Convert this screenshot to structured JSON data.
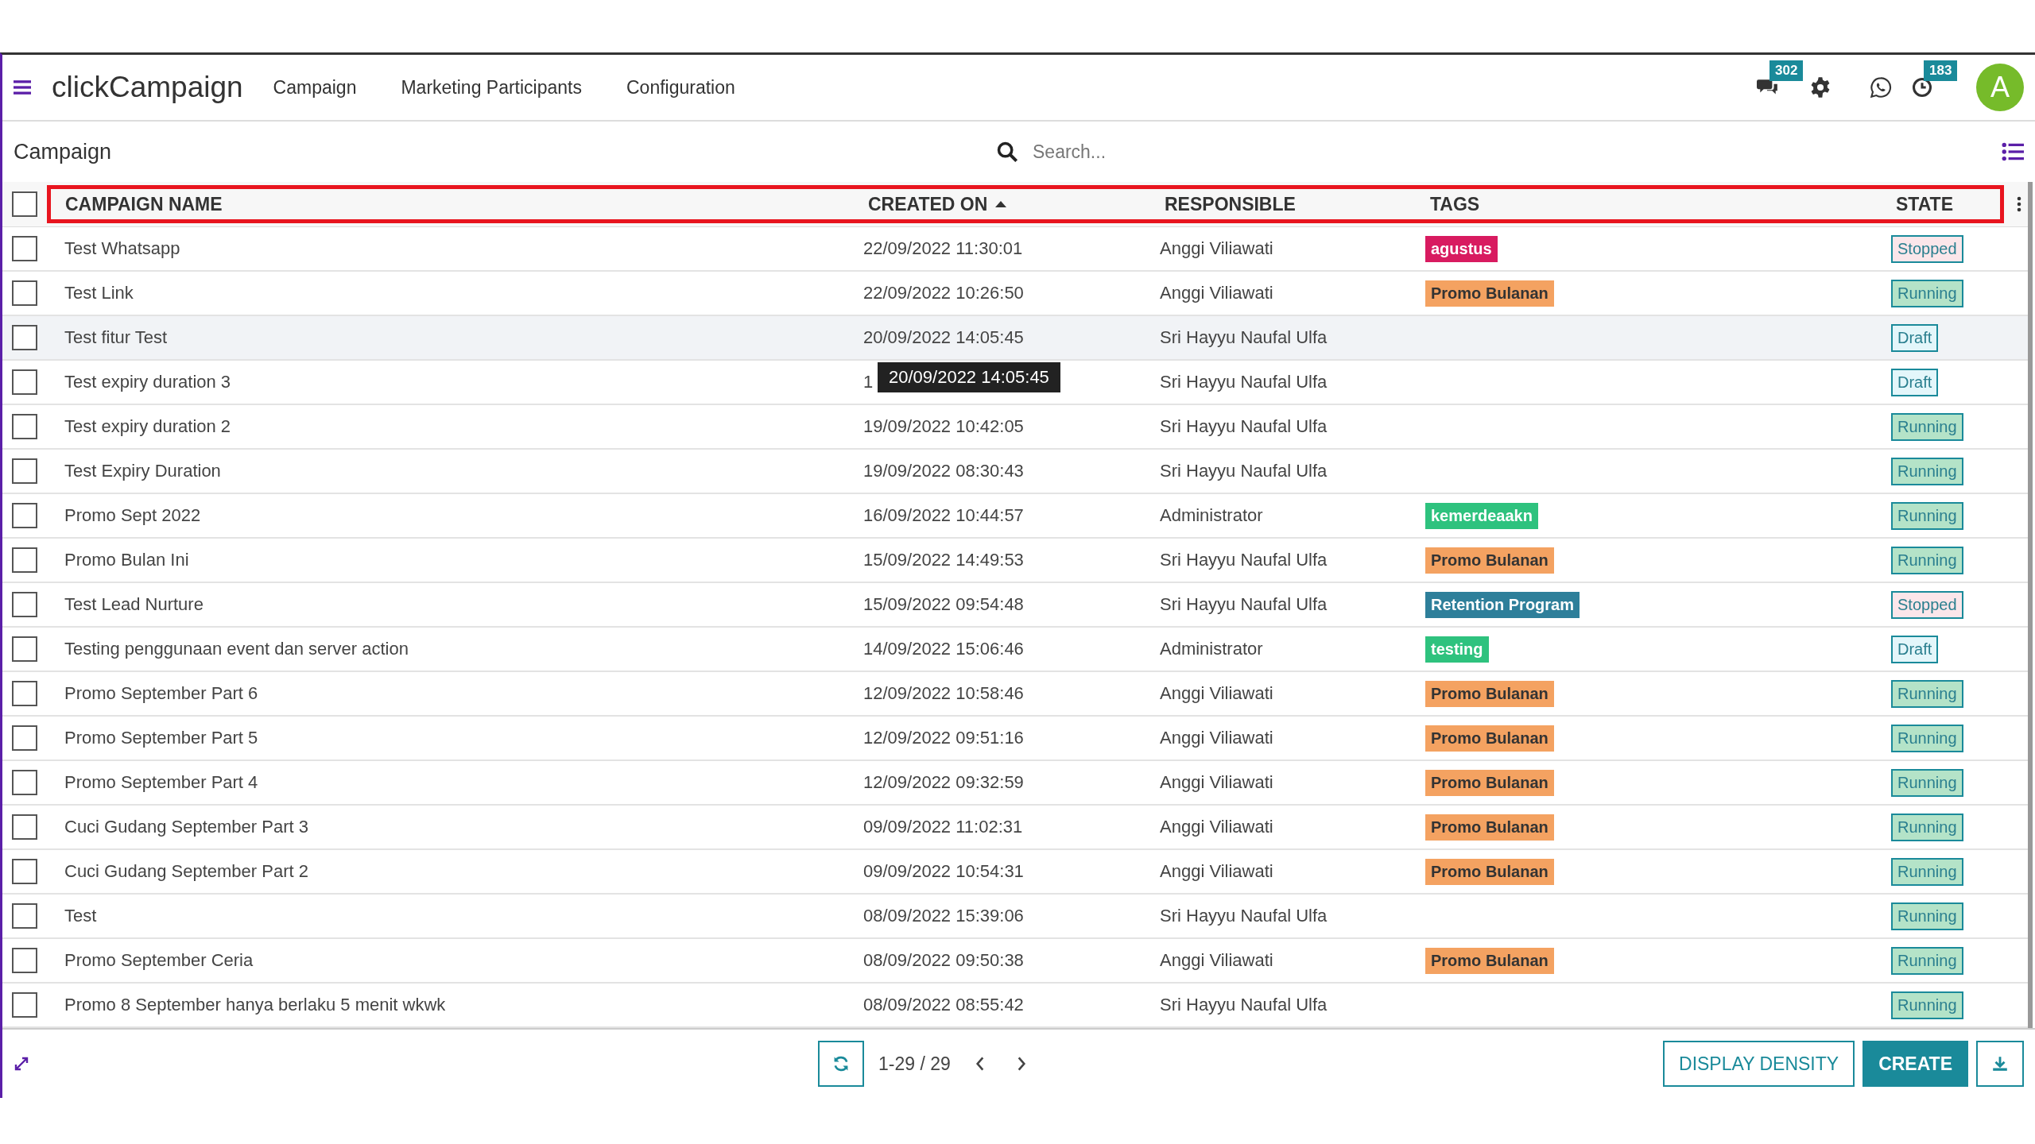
{
  "navbar": {
    "brand": "clickCampaign",
    "menu": [
      "Campaign",
      "Marketing Participants",
      "Configuration"
    ],
    "messages_badge": "302",
    "activity_badge": "183",
    "avatar_initial": "A"
  },
  "page": {
    "title": "Campaign",
    "search": {
      "placeholder": "Search..."
    }
  },
  "table": {
    "select_all_checked": false,
    "columns": [
      {
        "label": "CAMPAIGN NAME",
        "sorted": false
      },
      {
        "label": "CREATED ON",
        "sorted": true
      },
      {
        "label": "RESPONSIBLE",
        "sorted": false
      },
      {
        "label": "TAGS",
        "sorted": false
      },
      {
        "label": "STATE",
        "sorted": false
      }
    ],
    "rows": [
      {
        "name": "Test Whatsapp",
        "created": "22/09/2022 11:30:01",
        "responsible": "Anggi Viliawati",
        "tags": [
          {
            "label": "agustus",
            "color": "#d81b60"
          }
        ],
        "state": {
          "label": "Stopped",
          "kind": "stopped"
        },
        "checked": false,
        "highlighted": false
      },
      {
        "name": "Test Link",
        "created": "22/09/2022 10:26:50",
        "responsible": "Anggi Viliawati",
        "tags": [
          {
            "label": "Promo Bulanan",
            "color": "#f4a261"
          }
        ],
        "state": {
          "label": "Running",
          "kind": "running"
        },
        "checked": false,
        "highlighted": false
      },
      {
        "name": "Test fitur Test",
        "created": "20/09/2022 14:05:45",
        "responsible": "Sri Hayyu Naufal Ulfa",
        "tags": [],
        "state": {
          "label": "Draft",
          "kind": "draft"
        },
        "checked": false,
        "highlighted": true
      },
      {
        "name": "Test expiry duration 3",
        "created": "1",
        "tooltip": "20/09/2022 14:05:45",
        "responsible": "Sri Hayyu Naufal Ulfa",
        "tags": [],
        "state": {
          "label": "Draft",
          "kind": "draft"
        },
        "checked": false,
        "highlighted": false
      },
      {
        "name": "Test expiry duration 2",
        "created": "19/09/2022 10:42:05",
        "responsible": "Sri Hayyu Naufal Ulfa",
        "tags": [],
        "state": {
          "label": "Running",
          "kind": "running"
        },
        "checked": false,
        "highlighted": false
      },
      {
        "name": "Test Expiry Duration",
        "created": "19/09/2022 08:30:43",
        "responsible": "Sri Hayyu Naufal Ulfa",
        "tags": [],
        "state": {
          "label": "Running",
          "kind": "running"
        },
        "checked": false,
        "highlighted": false
      },
      {
        "name": "Promo Sept 2022",
        "created": "16/09/2022 10:44:57",
        "responsible": "Administrator",
        "tags": [
          {
            "label": "kemerdeaakn",
            "color": "#2ec27e"
          }
        ],
        "state": {
          "label": "Running",
          "kind": "running"
        },
        "checked": false,
        "highlighted": false
      },
      {
        "name": "Promo Bulan Ini",
        "created": "15/09/2022 14:49:53",
        "responsible": "Sri Hayyu Naufal Ulfa",
        "tags": [
          {
            "label": "Promo Bulanan",
            "color": "#f4a261"
          }
        ],
        "state": {
          "label": "Running",
          "kind": "running"
        },
        "checked": false,
        "highlighted": false
      },
      {
        "name": "Test Lead Nurture",
        "created": "15/09/2022 09:54:48",
        "responsible": "Sri Hayyu Naufal Ulfa",
        "tags": [
          {
            "label": "Retention Program",
            "color": "#2e7f9a"
          }
        ],
        "state": {
          "label": "Stopped",
          "kind": "stopped"
        },
        "checked": false,
        "highlighted": false
      },
      {
        "name": "Testing penggunaan event dan server action",
        "created": "14/09/2022 15:06:46",
        "responsible": "Administrator",
        "tags": [
          {
            "label": "testing",
            "color": "#2ec27e"
          }
        ],
        "state": {
          "label": "Draft",
          "kind": "draft"
        },
        "checked": false,
        "highlighted": false
      },
      {
        "name": "Promo September Part 6",
        "created": "12/09/2022 10:58:46",
        "responsible": "Anggi Viliawati",
        "tags": [
          {
            "label": "Promo Bulanan",
            "color": "#f4a261"
          }
        ],
        "state": {
          "label": "Running",
          "kind": "running"
        },
        "checked": false,
        "highlighted": false
      },
      {
        "name": "Promo September Part 5",
        "created": "12/09/2022 09:51:16",
        "responsible": "Anggi Viliawati",
        "tags": [
          {
            "label": "Promo Bulanan",
            "color": "#f4a261"
          }
        ],
        "state": {
          "label": "Running",
          "kind": "running"
        },
        "checked": false,
        "highlighted": false
      },
      {
        "name": "Promo September Part 4",
        "created": "12/09/2022 09:32:59",
        "responsible": "Anggi Viliawati",
        "tags": [
          {
            "label": "Promo Bulanan",
            "color": "#f4a261"
          }
        ],
        "state": {
          "label": "Running",
          "kind": "running"
        },
        "checked": false,
        "highlighted": false
      },
      {
        "name": "Cuci Gudang September Part 3",
        "created": "09/09/2022 11:02:31",
        "responsible": "Anggi Viliawati",
        "tags": [
          {
            "label": "Promo Bulanan",
            "color": "#f4a261"
          }
        ],
        "state": {
          "label": "Running",
          "kind": "running"
        },
        "checked": false,
        "highlighted": false
      },
      {
        "name": "Cuci Gudang September Part 2",
        "created": "09/09/2022 10:54:31",
        "responsible": "Anggi Viliawati",
        "tags": [
          {
            "label": "Promo Bulanan",
            "color": "#f4a261"
          }
        ],
        "state": {
          "label": "Running",
          "kind": "running"
        },
        "checked": false,
        "highlighted": false
      },
      {
        "name": "Test",
        "created": "08/09/2022 15:39:06",
        "responsible": "Sri Hayyu Naufal Ulfa",
        "tags": [],
        "state": {
          "label": "Running",
          "kind": "running"
        },
        "checked": false,
        "highlighted": false
      },
      {
        "name": "Promo September Ceria",
        "created": "08/09/2022 09:50:38",
        "responsible": "Anggi Viliawati",
        "tags": [
          {
            "label": "Promo Bulanan",
            "color": "#f4a261"
          }
        ],
        "state": {
          "label": "Running",
          "kind": "running"
        },
        "checked": false,
        "highlighted": false
      },
      {
        "name": "Promo 8 September hanya berlaku 5 menit wkwk",
        "created": "08/09/2022 08:55:42",
        "responsible": "Sri Hayyu Naufal Ulfa",
        "tags": [],
        "state": {
          "label": "Running",
          "kind": "running"
        },
        "checked": false,
        "highlighted": false
      }
    ]
  },
  "footer": {
    "pager": "1-29 / 29",
    "buttons": [
      "DISPLAY DENSITY",
      "CREATE"
    ]
  }
}
